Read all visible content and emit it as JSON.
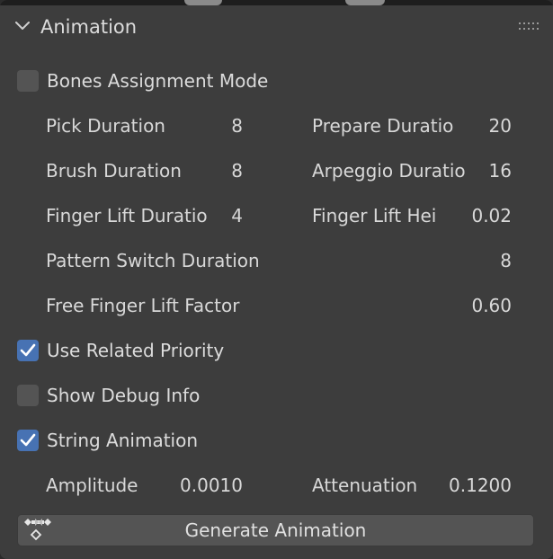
{
  "panel": {
    "title": "Animation",
    "collapse_icon": "chevron-down-icon",
    "drag_icon": "grip-dots-icon"
  },
  "colors": {
    "panel_bg": "#3d3d3d",
    "checkbox_bg": "#545454",
    "checkbox_checked": "#4772b3",
    "text": "#d8d8d8"
  },
  "bones_assignment_mode": {
    "label": "Bones Assignment Mode",
    "checked": false
  },
  "fields": {
    "pick_duration": {
      "label": "Pick Duration",
      "value": "8"
    },
    "prepare_duration": {
      "label": "Prepare Duratio",
      "value": "20"
    },
    "brush_duration": {
      "label": "Brush Duration",
      "value": "8"
    },
    "arpeggio_duration": {
      "label": "Arpeggio Duratio",
      "value": "16"
    },
    "finger_lift_duration": {
      "label": "Finger Lift Duratio",
      "value": "4"
    },
    "finger_lift_height": {
      "label": "Finger Lift Hei",
      "value": "0.02"
    },
    "pattern_switch_duration": {
      "label": "Pattern Switch Duration",
      "value": "8"
    },
    "free_finger_lift_factor": {
      "label": "Free Finger Lift Factor",
      "value": "0.60"
    },
    "amplitude": {
      "label": "Amplitude",
      "value": "0.0010"
    },
    "attenuation": {
      "label": "Attenuation",
      "value": "0.1200"
    }
  },
  "use_related_priority": {
    "label": "Use Related Priority",
    "checked": true
  },
  "show_debug_info": {
    "label": "Show Debug Info",
    "checked": false
  },
  "string_animation": {
    "label": "String Animation",
    "checked": true
  },
  "generate_button": {
    "label": "Generate Animation",
    "icon": "keyframes-icon"
  }
}
